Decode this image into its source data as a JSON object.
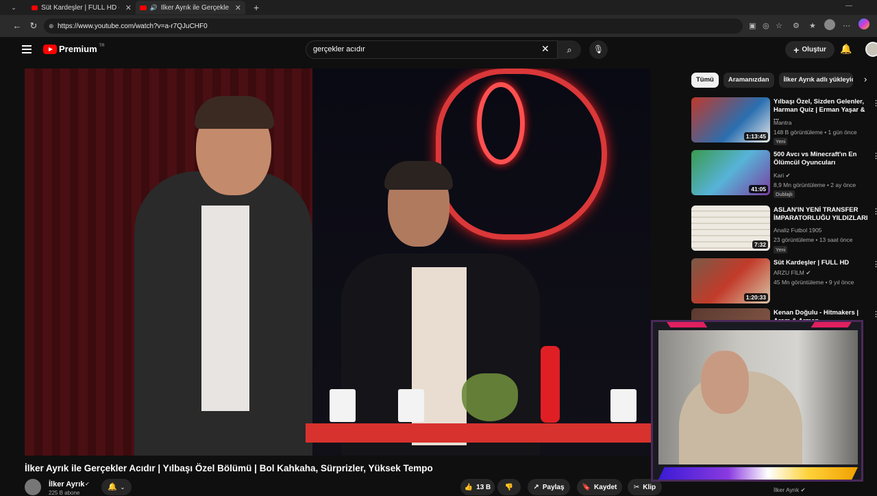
{
  "browser": {
    "tabs": [
      {
        "label": "Süt Kardeşler | FULL HD - YouTube"
      },
      {
        "label": "İlker Ayrık ile Gerçekler Acıdır"
      }
    ],
    "url": "https://www.youtube.com/watch?v=a-r7QJuCHF0"
  },
  "youtube": {
    "logo_text": "Premium",
    "region": "TR",
    "search_value": "gerçekler acıdır",
    "create_label": "Oluştur"
  },
  "video": {
    "title": "İlker Ayrık ile Gerçekler Acıdır | Yılbaşı Özel Bölümü | Bol Kahkaha, Sürprizler, Yüksek Tempo",
    "channel": "İlker Ayrık",
    "subscribers": "225 B abone",
    "likes": "13 B",
    "share_label": "Paylaş",
    "save_label": "Kaydet",
    "clip_label": "Klip"
  },
  "chips": [
    {
      "label": "Tümü",
      "active": true
    },
    {
      "label": "Aramanızdan"
    },
    {
      "label": "İlker Ayrık adlı yükleyici"
    }
  ],
  "recommendations": [
    {
      "title": "Yılbaşı Özel, Sizden Gelenler, Harman Quiz | Erman Yaşar & ...",
      "channel": "Mantra",
      "meta": "148 B görüntüleme • 1 gün önce",
      "badge": "Yeni",
      "duration": "1:13:45",
      "thumb_color": "#b8342e"
    },
    {
      "title": "500 Avcı vs Minecraft'ın En Ölümcül Oyuncuları",
      "channel": "Kari",
      "meta": "8,9 Mn görüntüleme • 2 ay önce",
      "badge": "Dublajlı",
      "duration": "41:05",
      "thumb_color": "#3c8a4a"
    },
    {
      "title": "ASLAN'IN YENİ TRANSFER İMPARATORLUĞU YILDIZLARI",
      "channel": "Analiz Futbol 1905",
      "meta": "23 görüntüleme • 13 saat önce",
      "badge": "Yeni",
      "duration": "7:32",
      "thumb_color": "#e9e6df"
    },
    {
      "title": "Süt Kardeşler | FULL HD",
      "channel": "ARZU FİLM",
      "meta": "45 Mn görüntüleme • 9 yıl önce",
      "badge": "",
      "duration": "1:20:33",
      "thumb_color": "#7a5040"
    },
    {
      "title": "Kenan Doğulu - Hitmakers | Arem & Arman",
      "channel": "",
      "meta": "",
      "badge": "",
      "duration": "",
      "thumb_color": "#5a3a30"
    }
  ],
  "bottom_partial_channel": "İlker Ayrık"
}
